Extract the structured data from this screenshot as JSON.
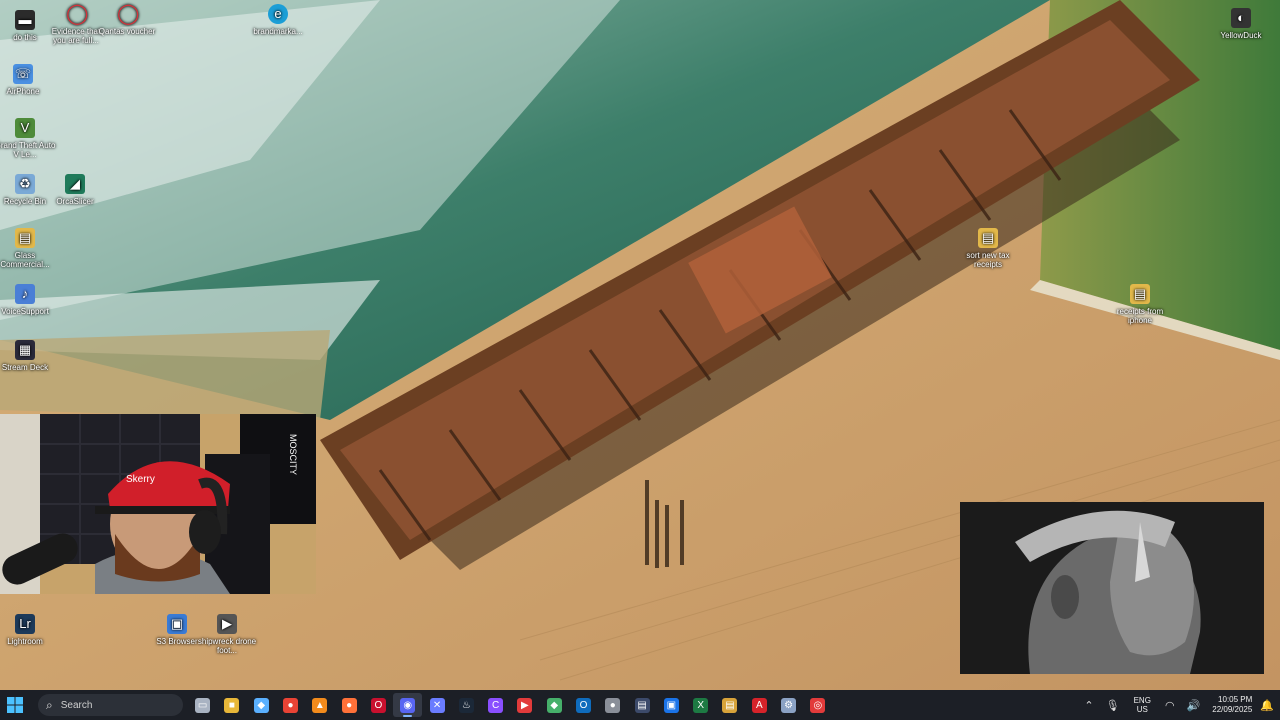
{
  "desktop": {
    "icons_left_column": [
      {
        "label": "do this",
        "icon": "document-icon",
        "color": "#2b2b2b"
      },
      {
        "label": "AirPhone",
        "icon": "phone-app-icon",
        "color": "#4a90e2"
      },
      {
        "label": "Grand Theft Auto V Le...",
        "icon": "game-icon",
        "color": "#4e8b3a"
      },
      {
        "label": "Recycle Bin",
        "icon": "recycle-bin-icon",
        "color": "#7aa9d6"
      },
      {
        "label": "OrcaSlicer",
        "icon": "orcaslicer-icon",
        "color": "#1f7a5a"
      },
      {
        "label": "Glass Commercial...",
        "icon": "folder-icon",
        "color": "#e2b84a"
      },
      {
        "label": "VoiceSupport",
        "icon": "voice-icon",
        "color": "#4a7fd6"
      },
      {
        "label": "Stream Deck",
        "icon": "stream-deck-icon",
        "color": "#2a2a3a"
      }
    ],
    "icons_top": [
      {
        "label": "Evidence that you are full...",
        "icon": "opera-icon",
        "color": "#d6323a"
      },
      {
        "label": "Qantas voucher",
        "icon": "opera-icon",
        "color": "#d6323a"
      },
      {
        "label": "brandmarka...",
        "icon": "edge-icon",
        "color": "#1b9ed6"
      }
    ],
    "icons_right": [
      {
        "label": "YellowDuck",
        "icon": "yellowduck-icon",
        "color": "#333333"
      },
      {
        "label": "sort new tax receipts",
        "icon": "folder-icon",
        "color": "#e2b84a"
      },
      {
        "label": "receipts from iphone",
        "icon": "folder-icon",
        "color": "#e2b84a"
      }
    ],
    "icons_bottom": [
      {
        "label": "Lightroom",
        "icon": "lightroom-icon",
        "color": "#1d3a5a"
      },
      {
        "label": "S3 Browser",
        "icon": "s3-browser-icon",
        "color": "#3a7bd5"
      },
      {
        "label": "shipwreck drone foot...",
        "icon": "video-file-icon",
        "color": "#555555"
      }
    ]
  },
  "webcam": {
    "cap_text": "Skerry",
    "banner_text": "MOSCITY"
  },
  "taskbar": {
    "search_placeholder": "Search",
    "apps": [
      {
        "name": "file-explorer-blank",
        "color": "#a9b3c2",
        "glyph": "▭"
      },
      {
        "name": "file-explorer",
        "color": "#e8b739",
        "glyph": "■"
      },
      {
        "name": "copilot",
        "color": "#5ab0ff",
        "glyph": "◆"
      },
      {
        "name": "chrome",
        "color": "#e94335",
        "glyph": "●"
      },
      {
        "name": "vlc",
        "color": "#f28b1c",
        "glyph": "▲"
      },
      {
        "name": "firefox",
        "color": "#ff7139",
        "glyph": "●"
      },
      {
        "name": "opera",
        "color": "#c8102e",
        "glyph": "O"
      },
      {
        "name": "discord",
        "color": "#5865f2",
        "glyph": "◉",
        "active": true
      },
      {
        "name": "davinci",
        "color": "#6a7cff",
        "glyph": "✕"
      },
      {
        "name": "steam",
        "color": "#1b2838",
        "glyph": "♨"
      },
      {
        "name": "app-purple",
        "color": "#8a4fff",
        "glyph": "C"
      },
      {
        "name": "youtube",
        "color": "#e23b3b",
        "glyph": "▶"
      },
      {
        "name": "app-shield",
        "color": "#46b06a",
        "glyph": "◆"
      },
      {
        "name": "outlook",
        "color": "#0f6cbd",
        "glyph": "O"
      },
      {
        "name": "app-gray",
        "color": "#8a8f99",
        "glyph": "●"
      },
      {
        "name": "app-terminal",
        "color": "#3c4a6a",
        "glyph": "▤"
      },
      {
        "name": "app-blue",
        "color": "#1a73e8",
        "glyph": "▣"
      },
      {
        "name": "excel",
        "color": "#1d7a43",
        "glyph": "X"
      },
      {
        "name": "app-files",
        "color": "#d8a33a",
        "glyph": "▤"
      },
      {
        "name": "acrobat",
        "color": "#d6232a",
        "glyph": "A"
      },
      {
        "name": "settings",
        "color": "#8ba2c4",
        "glyph": "⚙"
      },
      {
        "name": "app-red-circle",
        "color": "#e23b3b",
        "glyph": "◎"
      }
    ],
    "tray": {
      "language_top": "ENG",
      "language_bottom": "US",
      "time": "10:05 PM",
      "date": "22/09/2025"
    }
  }
}
